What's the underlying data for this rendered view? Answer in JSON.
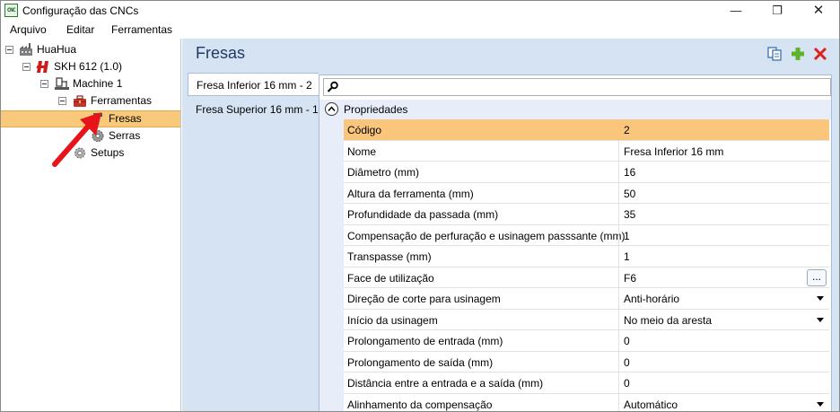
{
  "window": {
    "title": "Configuração das CNCs",
    "app_icon_text": "CNC",
    "controls": {
      "minimize": "—",
      "maximize": "❐",
      "close": "✕"
    }
  },
  "menu": [
    "Arquivo",
    "Editar",
    "Ferramentas"
  ],
  "tree": {
    "items": [
      {
        "label": "HuaHua",
        "icon": "factory-icon"
      },
      {
        "label": "SKH 612 (1.0)",
        "icon": "brand-logo-icon"
      },
      {
        "label": "Machine 1",
        "icon": "machine-icon"
      },
      {
        "label": "Ferramentas",
        "icon": "toolbox-icon"
      },
      {
        "label": "Fresas",
        "icon": "drill-bit-icon",
        "selected": true
      },
      {
        "label": "Serras",
        "icon": "saw-blade-icon"
      },
      {
        "label": "Setups",
        "icon": "gear-icon"
      }
    ]
  },
  "pane": {
    "title": "Fresas",
    "toolbar": {
      "copy": "copy-icon",
      "add": "add-icon",
      "delete": "delete-icon"
    }
  },
  "tabs": [
    {
      "label": "Fresa Inferior 16 mm - 2",
      "active": true
    },
    {
      "label": "Fresa Superior 16 mm - 1",
      "active": false
    }
  ],
  "search": {
    "placeholder": "",
    "value": ""
  },
  "group": {
    "label": "Propriedades"
  },
  "properties": [
    {
      "name": "Código",
      "value": "2",
      "selected": true
    },
    {
      "name": "Nome",
      "value": "Fresa Inferior 16 mm"
    },
    {
      "name": "Diâmetro (mm)",
      "value": "16"
    },
    {
      "name": "Altura da ferramenta (mm)",
      "value": "50"
    },
    {
      "name": "Profundidade da passada (mm)",
      "value": "35"
    },
    {
      "name": "Compensação de perfuração e usinagem passsante (mm)",
      "value": "1"
    },
    {
      "name": "Transpasse (mm)",
      "value": "1"
    },
    {
      "name": "Face de utilização",
      "value": "F6",
      "editor": "ellipsis",
      "button_label": "..."
    },
    {
      "name": "Direção de corte para usinagem",
      "value": "Anti-horário",
      "editor": "dropdown"
    },
    {
      "name": "Início da usinagem",
      "value": "No meio da aresta",
      "editor": "dropdown"
    },
    {
      "name": "Prolongamento de entrada (mm)",
      "value": "0"
    },
    {
      "name": "Prolongamento de saída (mm)",
      "value": "0"
    },
    {
      "name": "Distância entre a entrada e a saída (mm)",
      "value": "0"
    },
    {
      "name": "Alinhamento da compensação",
      "value": "Automático",
      "editor": "dropdown"
    }
  ],
  "colors": {
    "selection": "#f9c67b",
    "tree_selection": "#f8c97a",
    "panel_bg": "#d6e3f3",
    "title_color": "#1f3b63",
    "annotation_arrow": "#e8141c"
  }
}
